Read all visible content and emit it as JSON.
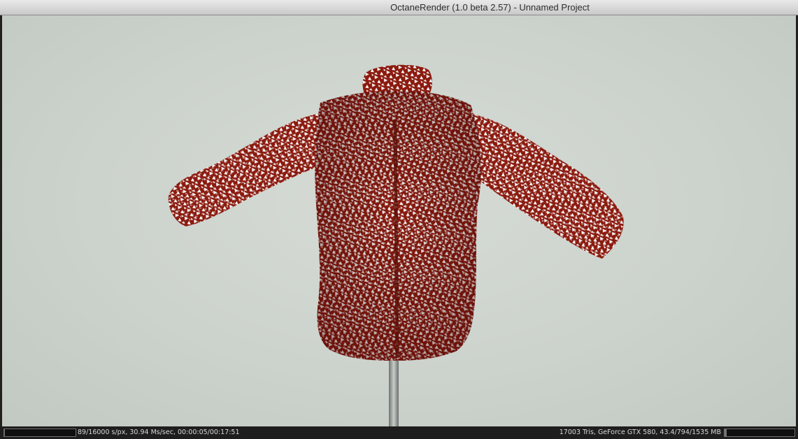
{
  "window": {
    "title": "OctaneRender (1.0 beta 2.57) - Unnamed Project"
  },
  "viewport": {
    "subject": "red-shirt-render",
    "background_color": "#d1d6d1",
    "shirt_color": "#8b1a0e",
    "stand_color": "#9aa09c"
  },
  "statusbar": {
    "render_stats": "89/16000 s/px, 30.94 Ms/sec, 00:00:05/00:17:51",
    "scene_stats": "17003 Tris, GeForce GTX 580, 43.4/794/1535 MB",
    "render_progress": 0.0056,
    "memory_usage": 0.03
  }
}
